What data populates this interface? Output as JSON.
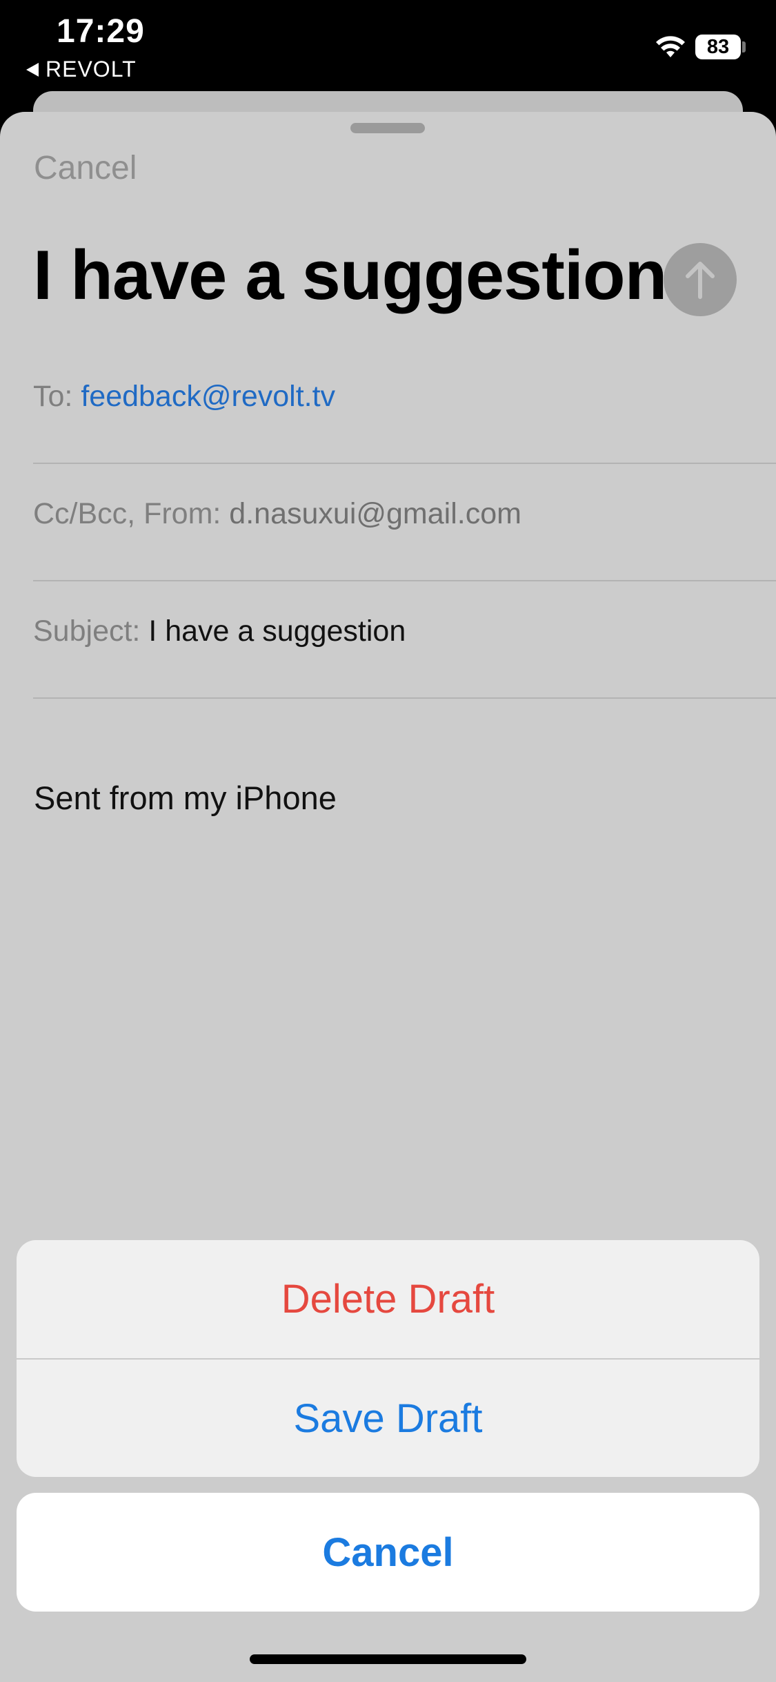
{
  "status_bar": {
    "time": "17:29",
    "back_app": "REVOLT",
    "battery": "83"
  },
  "compose": {
    "cancel_label": "Cancel",
    "title": "I have a suggestion",
    "to_label": "To:",
    "to_value": "feedback@revolt.tv",
    "ccbcc_label": "Cc/Bcc, From:",
    "from_value": "d.nasuxui@gmail.com",
    "subject_label": "Subject:",
    "subject_value": "I have a suggestion",
    "body": "Sent from my iPhone"
  },
  "action_sheet": {
    "delete_label": "Delete Draft",
    "save_label": "Save Draft",
    "cancel_label": "Cancel"
  },
  "colors": {
    "link_blue": "#1f6ac4",
    "action_blue": "#1b7be0",
    "destructive_red": "#e5483f"
  },
  "icons": {
    "send": "arrow-up-icon",
    "wifi": "wifi-icon",
    "battery": "battery-icon",
    "back": "back-arrow-icon"
  }
}
